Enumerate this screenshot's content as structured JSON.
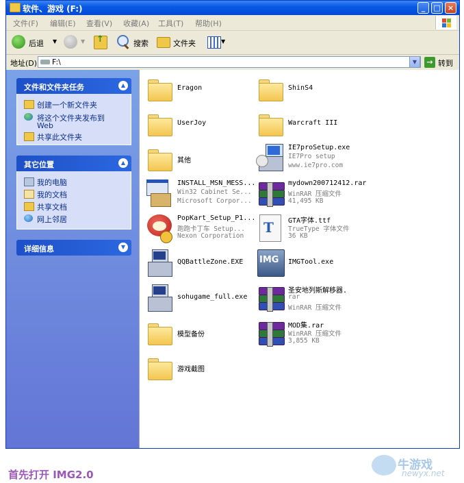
{
  "window": {
    "title": "软件、游戏 (F:)",
    "buttons": {
      "minimize": "_",
      "maximize": "□",
      "close": "×"
    }
  },
  "menubar": [
    {
      "label": "文件(F)"
    },
    {
      "label": "编辑(E)"
    },
    {
      "label": "查看(V)"
    },
    {
      "label": "收藏(A)"
    },
    {
      "label": "工具(T)"
    },
    {
      "label": "帮助(H)"
    }
  ],
  "toolbar": {
    "back_label": "后退",
    "search_label": "搜索",
    "folders_label": "文件夹"
  },
  "address": {
    "label": "地址(D)",
    "value": "F:\\",
    "go_label": "转到"
  },
  "taskpane": {
    "file_tasks": {
      "title": "文件和文件夹任务",
      "items": [
        {
          "label": "创建一个新文件夹"
        },
        {
          "label": "将这个文件夹发布到"
        },
        {
          "label": "Web"
        },
        {
          "label": "共享此文件夹"
        }
      ]
    },
    "other_places": {
      "title": "其它位置",
      "items": [
        {
          "label": "我的电脑"
        },
        {
          "label": "我的文档"
        },
        {
          "label": "共享文档"
        },
        {
          "label": "网上邻居"
        }
      ]
    },
    "details": {
      "title": "详细信息"
    }
  },
  "files": {
    "left": [
      {
        "name": "Eragon",
        "icon": "folder-icon"
      },
      {
        "name": "UserJoy",
        "icon": "folder-icon"
      },
      {
        "name": "其他",
        "icon": "folder-icon"
      },
      {
        "name": "INSTALL_MSN_MESS...",
        "line2": "Win32 Cabinet Se...",
        "line3": "Microsoft Corpor...",
        "icon": "installer-icon"
      },
      {
        "name": "PopKart_Setup_P1...",
        "line2": "跑跑卡丁车 Setup...",
        "line3": "Nexon Corporation",
        "icon": "popkart-icon"
      },
      {
        "name": "QQBattleZone.EXE",
        "icon": "setup-icon"
      },
      {
        "name": "sohugame_full.exe",
        "icon": "setup-icon"
      },
      {
        "name": "模型备份",
        "icon": "folder-icon"
      },
      {
        "name": "游戏截图",
        "icon": "folder-icon"
      }
    ],
    "right": [
      {
        "name": "ShinS4",
        "icon": "folder-icon"
      },
      {
        "name": "Warcraft III",
        "icon": "folder-icon"
      },
      {
        "name": "IE7proSetup.exe",
        "line2": "IE7Pro setup",
        "line3": "www.ie7pro.com",
        "icon": "ie7pro-setup-icon"
      },
      {
        "name": "mydown200712412.rar",
        "line2": "WinRAR 压缩文件",
        "line3": "41,495 KB",
        "icon": "winrar-icon"
      },
      {
        "name": "GTA字体.ttf",
        "line2": "TrueType 字体文件",
        "line3": "36 KB",
        "icon": "truetype-font-icon"
      },
      {
        "name": "IMGTool.exe",
        "icon": "imgtool-icon"
      },
      {
        "name": "圣安地列斯解移器.",
        "line2": "rar",
        "line3": "WinRAR 压缩文件",
        "icon": "winrar-icon"
      },
      {
        "name": "MOD集.rar",
        "line2": "WinRAR 压缩文件",
        "line3": "3,855 KB",
        "icon": "winrar-icon"
      }
    ]
  },
  "caption": "首先打开 IMG2.0",
  "watermark": {
    "text": "牛游戏",
    "url": "newyx.net"
  }
}
